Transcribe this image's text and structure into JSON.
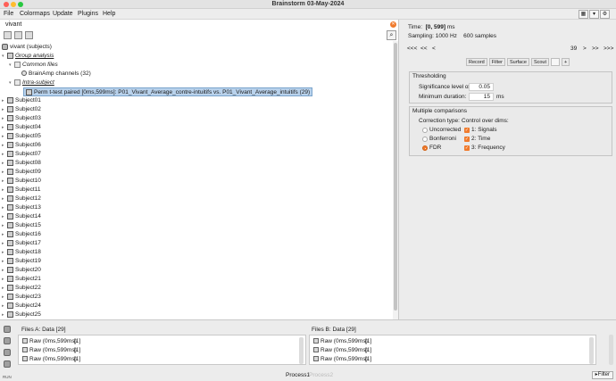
{
  "window": {
    "title": "Brainstorm 03-May-2024"
  },
  "menu": {
    "items": [
      "File",
      "Colormaps",
      "Update",
      "Plugins",
      "Help"
    ]
  },
  "search": {
    "value": "vivant"
  },
  "tree": {
    "root": "vivant (subjects)",
    "group": "Group analysis",
    "common": "Common files",
    "channels": "BrainAmp channels (32)",
    "intra": "Intra-subject",
    "selected_file": "Perm t-test paired [0ms,599ms]: P01_Vivant_Average_contre-intuitifs vs. P01_Vivant_Average_intuitifs (29)",
    "subjects": [
      "Subject01",
      "Subject02",
      "Subject03",
      "Subject04",
      "Subject05",
      "Subject06",
      "Subject07",
      "Subject08",
      "Subject09",
      "Subject10",
      "Subject11",
      "Subject12",
      "Subject13",
      "Subject14",
      "Subject15",
      "Subject16",
      "Subject17",
      "Subject18",
      "Subject19",
      "Subject20",
      "Subject21",
      "Subject22",
      "Subject23",
      "Subject24",
      "Subject25"
    ]
  },
  "info": {
    "time_label": "Time:",
    "time_value": "[0, 599]",
    "time_unit": "ms",
    "sampling_label": "Sampling: 1000 Hz",
    "samples": "600 samples"
  },
  "navigation": {
    "first": "<<<",
    "prev2": "<<",
    "prev": "<",
    "page": "39",
    "next": ">",
    "next2": ">>",
    "last": ">>>"
  },
  "tabs": [
    "Record",
    "Filter",
    "Surface",
    "Scout",
    "",
    "+"
  ],
  "thresholding": {
    "title": "Thresholding",
    "sig_label": "Significance level α:",
    "sig_value": "0.05",
    "dur_label": "Minimum duration:",
    "dur_value": "15",
    "dur_unit": "ms"
  },
  "multiple": {
    "title": "Multiple comparisons",
    "correction_label": "Correction type:",
    "control_label": "Control over dims:",
    "options": [
      "Uncorrected",
      "Bonferroni",
      "FDR"
    ],
    "selected_option": "FDR",
    "dims": [
      "1: Signals",
      "2: Time",
      "3: Frequency"
    ]
  },
  "files_a": {
    "title": "Files A: Data [29]",
    "rows": [
      {
        "name": "Raw (0ms,599ms)",
        "count": "[1]"
      },
      {
        "name": "Raw (0ms,599ms)",
        "count": "[1]"
      },
      {
        "name": "Raw (0ms,599ms)",
        "count": "[1]"
      }
    ]
  },
  "files_b": {
    "title": "Files B: Data [29]",
    "rows": [
      {
        "name": "Raw (0ms,599ms)",
        "count": "[1]"
      },
      {
        "name": "Raw (0ms,599ms)",
        "count": "[1]"
      },
      {
        "name": "Raw (0ms,599ms)",
        "count": "[1]"
      }
    ]
  },
  "bottom": {
    "process1": "Process1",
    "process2": "Process2",
    "filter": "Filter",
    "run": "RUN"
  },
  "colors": {
    "accent": "#f07a2c",
    "selection": "#b9d2ec"
  }
}
